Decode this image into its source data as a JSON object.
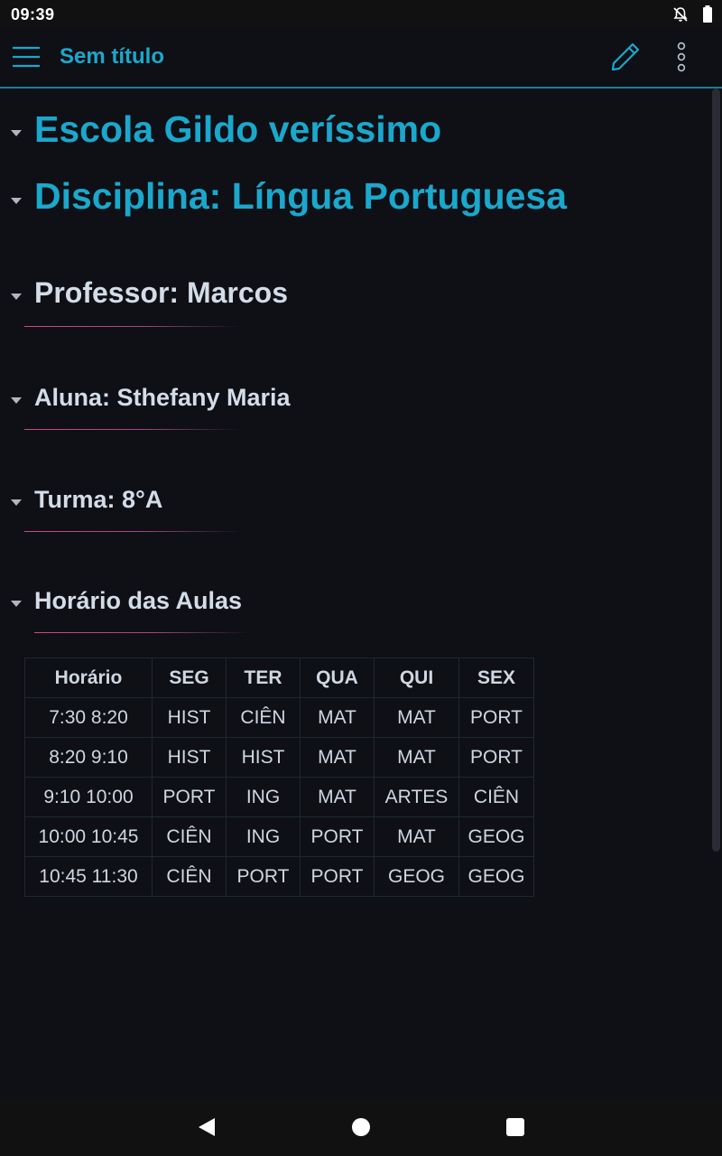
{
  "status_bar": {
    "time": "09:39",
    "icons": [
      "notifications-off-icon",
      "battery-icon"
    ]
  },
  "app_bar": {
    "title": "Sem título",
    "accent_color": "#1aa8cc",
    "icons": [
      "menu-icon",
      "edit-pencil-icon",
      "more-vert-icon"
    ]
  },
  "document": {
    "school": "Escola Gildo veríssimo",
    "discipline": "Disciplina: Língua Portuguesa",
    "teacher": "Professor: Marcos",
    "student": "Aluna: Sthefany Maria",
    "class": "Turma: 8°A",
    "schedule_title": "Horário das Aulas"
  },
  "schedule": {
    "headers": [
      "Horário",
      "SEG",
      "TER",
      "QUA",
      "QUI",
      "SEX"
    ],
    "rows": [
      [
        "7:30 8:20",
        "HIST",
        "CIÊN",
        "MAT",
        "MAT",
        "PORT"
      ],
      [
        "8:20 9:10",
        "HIST",
        "HIST",
        "MAT",
        "MAT",
        "PORT"
      ],
      [
        "9:10 10:00",
        "PORT",
        "ING",
        "MAT",
        "ARTES",
        "CIÊN"
      ],
      [
        "10:00 10:45",
        "CIÊN",
        "ING",
        "PORT",
        "MAT",
        "GEOG"
      ],
      [
        "10:45 11:30",
        "CIÊN",
        "PORT",
        "PORT",
        "GEOG",
        "GEOG"
      ]
    ]
  },
  "nav_bar": {
    "icons": [
      "back-icon",
      "home-icon",
      "recents-icon"
    ]
  }
}
